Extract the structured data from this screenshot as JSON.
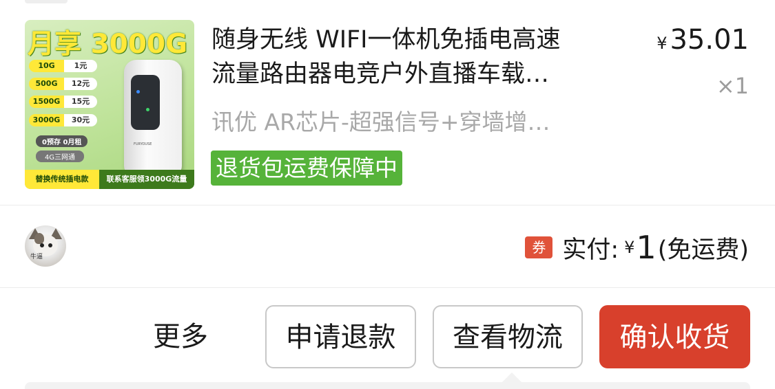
{
  "product": {
    "thumbnail": {
      "headline": "月享 3000G",
      "plans": [
        {
          "gb": "10G",
          "price": "1元"
        },
        {
          "gb": "500G",
          "price": "12元"
        },
        {
          "gb": "1500G",
          "price": "15元"
        },
        {
          "gb": "3000G",
          "price": "30元"
        }
      ],
      "note": "0预存 0月租",
      "network": "4G三网通",
      "brand": "FURYOUSE",
      "bottom_left": "替换传统插电款",
      "bottom_right": "联系客服领3000G流量"
    },
    "title_line1": "随身无线 WIFI一体机免插电高速",
    "title_line2": "流量路由器电竞户外直播车载…",
    "spec": "讯优 AR芯片-超强信号+穿墙增…",
    "return_badge": "退货包运费保障中",
    "price_currency": "¥",
    "price_value": "35.01",
    "quantity": "×1"
  },
  "payment": {
    "avatar_text": "牛逼",
    "coupon_label": "券",
    "label": "实付:",
    "currency": "¥",
    "amount": "1",
    "shipping_note": "(免运费)"
  },
  "actions": {
    "more": "更多",
    "refund": "申请退款",
    "logistics": "查看物流",
    "confirm": "确认收货"
  },
  "colors": {
    "return_badge": "#56b33a",
    "confirm_button": "#d8402c",
    "coupon_icon": "#e0523a",
    "spec_text": "#a8a8a8"
  }
}
